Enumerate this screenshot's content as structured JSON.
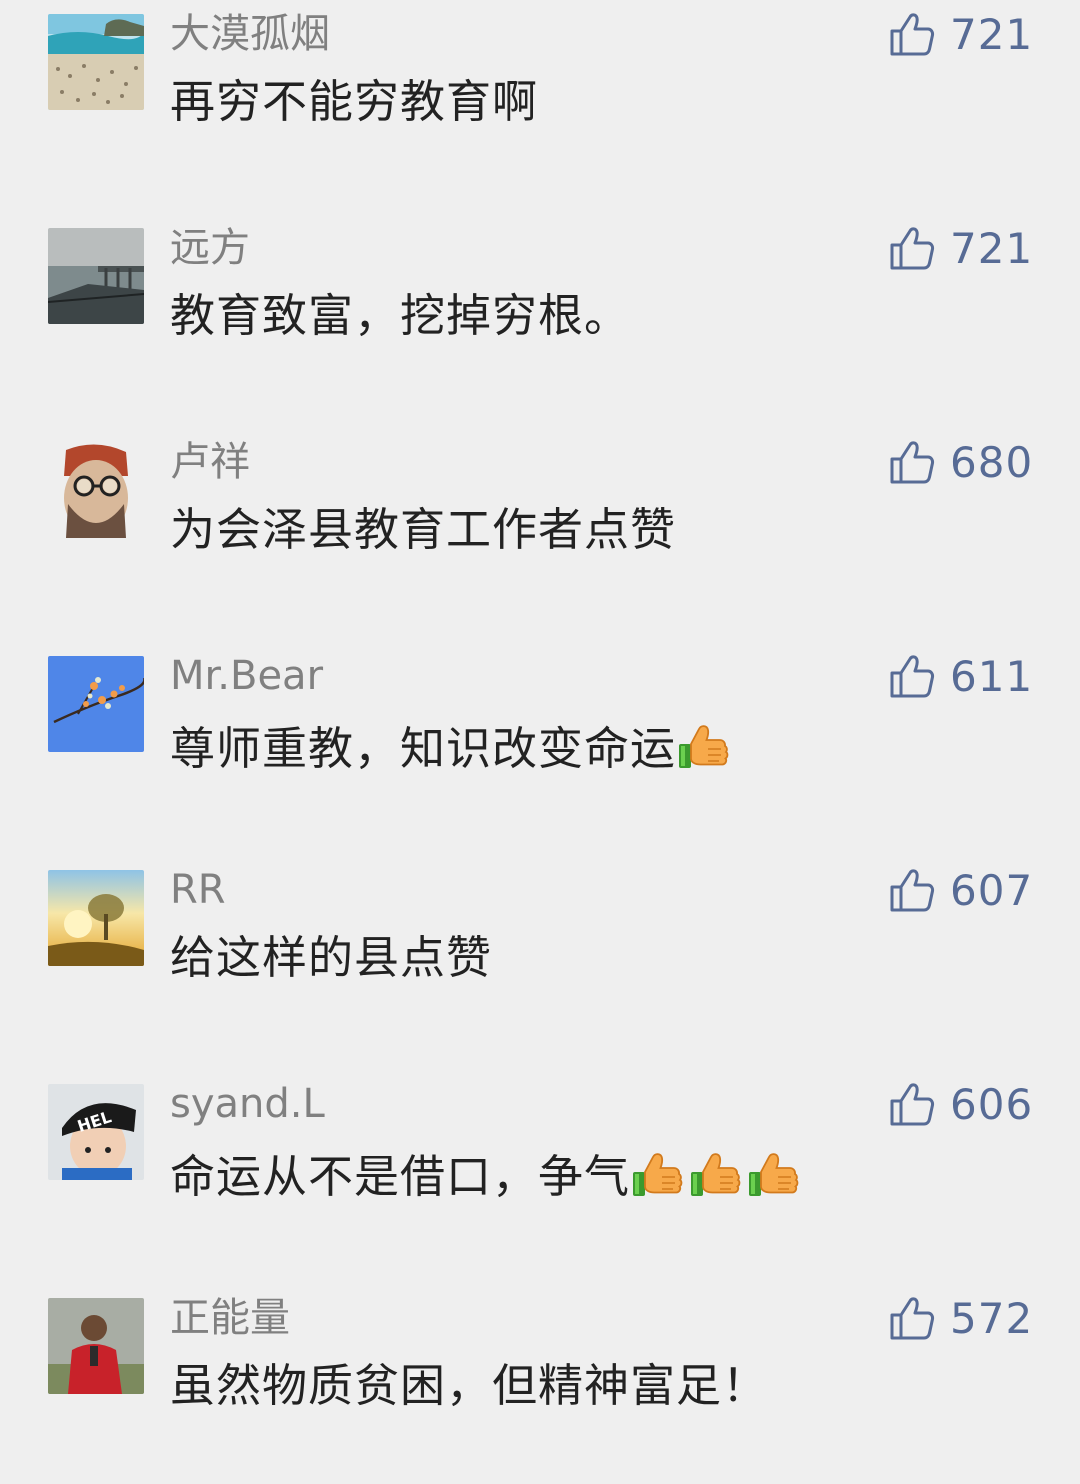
{
  "colors": {
    "background": "#efefef",
    "username": "#808080",
    "content": "#222222",
    "like_accent": "#576b95"
  },
  "comments": [
    {
      "username": "大漠孤烟",
      "text": "再穷不能穷教育啊",
      "likes": "721",
      "avatar_icon": "beach-avatar",
      "emoji_count": 0
    },
    {
      "username": "远方",
      "text": "教育致富，挖掉穷根。",
      "likes": "721",
      "avatar_icon": "lake-pier-avatar",
      "emoji_count": 0
    },
    {
      "username": "卢祥",
      "text": "为会泽县教育工作者点赞",
      "likes": "680",
      "avatar_icon": "sunglasses-man-avatar",
      "emoji_count": 0
    },
    {
      "username": "Mr.Bear",
      "text": "尊师重教，知识改变命运",
      "likes": "611",
      "avatar_icon": "branch-blue-sky-avatar",
      "emoji_count": 1
    },
    {
      "username": "RR",
      "text": "给这样的县点赞",
      "likes": "607",
      "avatar_icon": "sunrise-tree-avatar",
      "emoji_count": 0
    },
    {
      "username": "syand.L",
      "text": "命运从不是借口，争气",
      "likes": "606",
      "avatar_icon": "child-cap-avatar",
      "emoji_count": 3
    },
    {
      "username": "正能量",
      "text": "虽然物质贫困，但精神富足！",
      "likes": "572",
      "avatar_icon": "red-jacket-person-avatar",
      "emoji_count": 0
    }
  ]
}
